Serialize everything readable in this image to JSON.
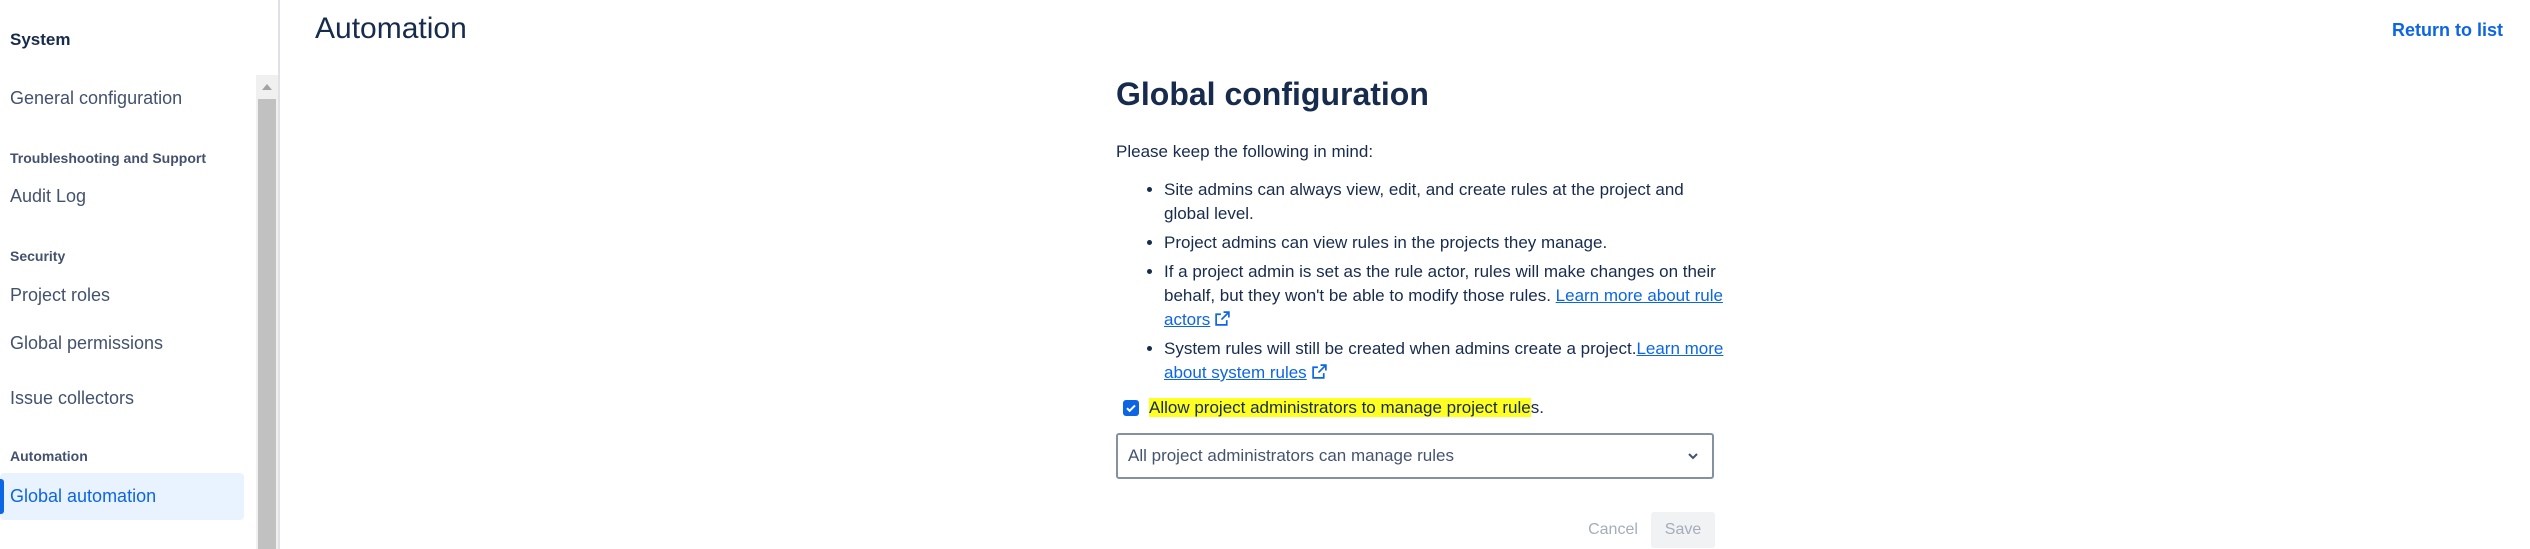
{
  "sidebar": {
    "title": "System",
    "items": [
      {
        "label": "General configuration"
      },
      {
        "heading": "Troubleshooting and Support"
      },
      {
        "label": "Audit Log"
      },
      {
        "heading": "Security"
      },
      {
        "label": "Project roles"
      },
      {
        "label": "Global permissions"
      },
      {
        "label": "Issue collectors"
      },
      {
        "heading": "Automation"
      },
      {
        "label": "Global automation",
        "selected": true
      }
    ]
  },
  "header": {
    "title": "Automation",
    "return_link": "Return to list"
  },
  "main": {
    "section_title": "Global configuration",
    "intro": "Please keep the following in mind:",
    "bullets": {
      "b1": "Site admins can always view, edit, and create rules at the project and global level.",
      "b2": "Project admins can view rules in the projects they manage.",
      "b3_text": "If a project admin is set as the rule actor, rules will make changes on their behalf, but they won't be able to modify those rules. ",
      "b3_link": "Learn more about rule actors",
      "b4_text": "System rules will still be created when admins create a project.",
      "b4_link": "Learn more about system rules"
    },
    "checkbox": {
      "checked": true,
      "label_highlighted": "Allow project administrators to manage project rule",
      "label_rest": "s."
    },
    "select": {
      "value": "All project administrators can manage rules"
    },
    "buttons": {
      "cancel": "Cancel",
      "save": "Save"
    }
  },
  "colors": {
    "accent": "#0c66e4",
    "highlight": "#ffff22",
    "selected_bg": "#e9f2ff"
  },
  "icons": [
    "external-link-icon",
    "checkmark-icon",
    "chevron-down-icon",
    "scroll-up-arrow-icon"
  ]
}
